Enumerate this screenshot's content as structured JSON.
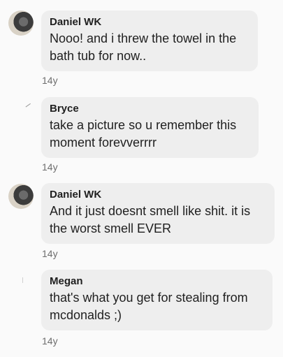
{
  "comments": [
    {
      "author": "Daniel WK",
      "text": "Nooo! and i threw the towel in the bath tub for now..",
      "time": "14y",
      "avatar_icon": "user-photo-icon"
    },
    {
      "author": "Bryce",
      "text": "take a picture so u remember this moment forevverrrr",
      "time": "14y",
      "avatar_icon": "user-blank-icon"
    },
    {
      "author": "Daniel WK",
      "text": "And it just doesnt smell like shit. it is the worst smell EVER",
      "time": "14y",
      "avatar_icon": "user-photo-icon"
    },
    {
      "author": "Megan",
      "text": "that's what you get for stealing from mcdonalds ;)",
      "time": "14y",
      "avatar_icon": "user-blank-icon"
    }
  ],
  "colors": {
    "background": "#fafafa",
    "bubble": "#eeeeee",
    "text": "#1f1f1f",
    "timestamp": "#6e6e6e"
  }
}
